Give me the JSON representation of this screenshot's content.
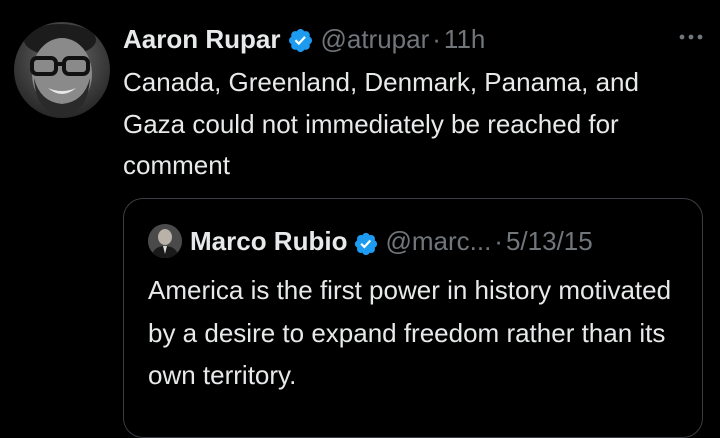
{
  "tweet": {
    "author_name": "Aaron Rupar",
    "handle": "@atrupar",
    "separator": "·",
    "time": "11h",
    "text": "Canada, Greenland, Denmark, Panama, and Gaza could not immediately be reached for comment",
    "avatar_icon": "user-avatar",
    "verified_icon": "verified-badge-icon",
    "more_icon": "more-options-icon"
  },
  "quoted_tweet": {
    "author_name": "Marco Rubio",
    "handle": "@marc...",
    "separator": "·",
    "date": "5/13/15",
    "text": "America is the first power in history motivated by a desire to expand freedom rather than its own territory.",
    "avatar_icon": "user-avatar",
    "verified_icon": "verified-badge-icon"
  },
  "colors": {
    "background": "#000000",
    "primary_text": "#e7e9ea",
    "secondary_text": "#71767b",
    "verified_blue": "#1d9bf0",
    "quote_border": "#3a3d41"
  }
}
